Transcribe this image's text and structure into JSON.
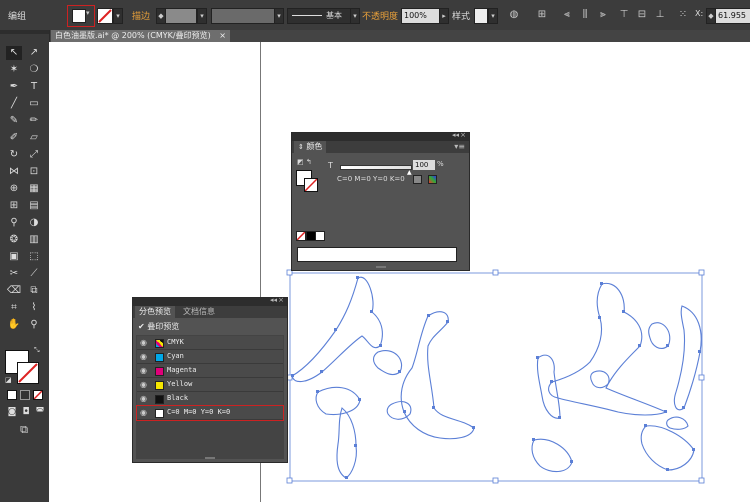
{
  "control_bar": {
    "group_label": "编组",
    "stroke_label": "描边",
    "stroke_style": "基本",
    "opacity_label": "不透明度",
    "opacity_value": "100%",
    "style_label": "样式",
    "coord_value": "61.955"
  },
  "document_tab": {
    "title": "白色油墨版.ai* @ 200% (CMYK/叠印预览)",
    "close": "×"
  },
  "color_panel": {
    "tab": "颜色",
    "channel": "T",
    "percent_value": "100",
    "percent_unit": "%",
    "cmyk_readout": "C=0  M=0  Y=0  K=0"
  },
  "separations_panel": {
    "tabs": [
      "分色预览",
      "文档信息"
    ],
    "overprint_label": "叠印预览",
    "rows": [
      {
        "name": "CMYK",
        "color": "#888888"
      },
      {
        "name": "Cyan",
        "color": "#00a8e8"
      },
      {
        "name": "Magenta",
        "color": "#e0007a"
      },
      {
        "name": "Yellow",
        "color": "#f5e600"
      },
      {
        "name": "Black",
        "color": "#111111"
      },
      {
        "name": "C=0 M=0 Y=0 K=0",
        "color": "#ffffff"
      }
    ]
  },
  "colors": {
    "path_stroke": "#5b7fd6",
    "highlight": "#cc2222",
    "panel_bg": "#535353"
  }
}
